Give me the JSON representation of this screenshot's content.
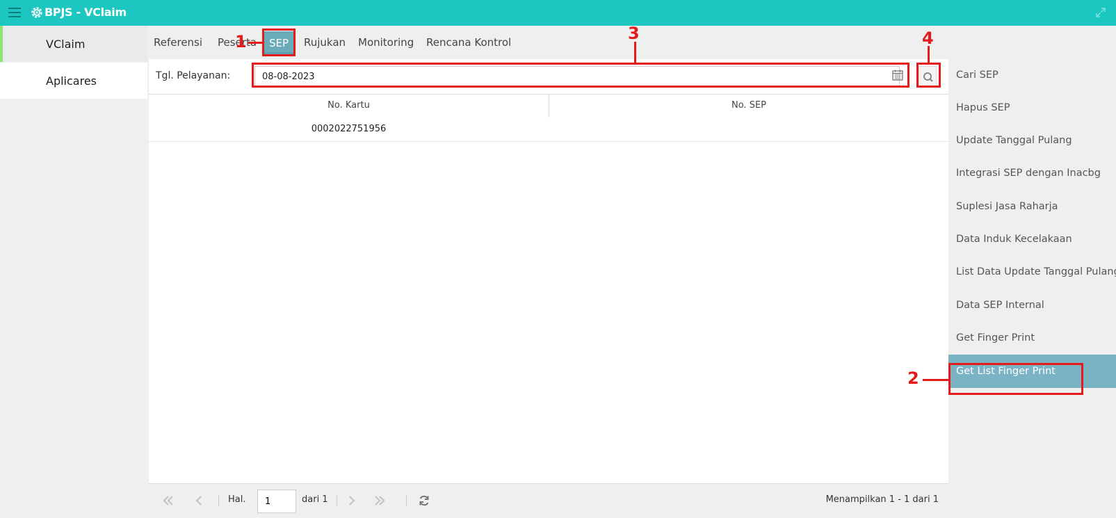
{
  "app": {
    "title": "BPJS - VClaim"
  },
  "sidebar": {
    "items": [
      {
        "label": "VClaim"
      },
      {
        "label": "Aplicares"
      }
    ]
  },
  "tabs": [
    {
      "label": "Referensi"
    },
    {
      "label": "Peserta"
    },
    {
      "label": "SEP",
      "active": true
    },
    {
      "label": "Rujukan"
    },
    {
      "label": "Monitoring"
    },
    {
      "label": "Rencana Kontrol"
    }
  ],
  "filter": {
    "label": "Tgl. Pelayanan:",
    "value": "08-08-2023"
  },
  "grid": {
    "columns": [
      "No. Kartu",
      "No. SEP"
    ],
    "rows": [
      [
        "0002022751956",
        ""
      ]
    ]
  },
  "pager": {
    "hal_label": "Hal.",
    "page": "1",
    "of_label": "dari 1",
    "info": "Menampilkan 1 - 1 dari 1"
  },
  "right_menu": [
    {
      "label": "Cari SEP"
    },
    {
      "label": "Hapus SEP"
    },
    {
      "label": "Update Tanggal Pulang"
    },
    {
      "label": "Integrasi SEP dengan Inacbg"
    },
    {
      "label": "Suplesi Jasa Raharja"
    },
    {
      "label": "Data Induk Kecelakaan"
    },
    {
      "label": "List Data Update Tanggal Pulang"
    },
    {
      "label": "Data SEP Internal"
    },
    {
      "label": "Get Finger Print"
    },
    {
      "label": "Get List Finger Print",
      "active": true
    }
  ],
  "annotations": [
    "1",
    "2",
    "3",
    "4"
  ],
  "colors": {
    "header": "#1cc7c1",
    "active_tab": "#6aabb9",
    "active_menu": "#7ab3c4",
    "annotation": "#e51b1b"
  },
  "icons": [
    "menu-icon",
    "gear-icon",
    "expand-icon",
    "calendar-icon",
    "search-icon",
    "first-page-icon",
    "prev-page-icon",
    "next-page-icon",
    "last-page-icon",
    "refresh-icon"
  ]
}
